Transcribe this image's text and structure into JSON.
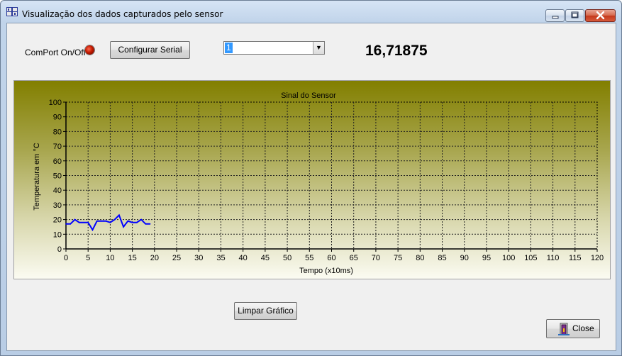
{
  "window": {
    "title": "Visualização dos dados capturados pelo sensor"
  },
  "toolbar": {
    "comport_label": "ComPort On/Off",
    "configure_label": "Configurar Serial",
    "port_select_value": "1",
    "reading_value": "16,71875"
  },
  "actions": {
    "clear_label": "Limpar Gráfico",
    "close_label": "Close"
  },
  "colors": {
    "series_line": "#0000ff",
    "led": "#cc2200"
  },
  "chart_data": {
    "type": "line",
    "title": "Sinal do Sensor",
    "xlabel": "Tempo (x10ms)",
    "ylabel": "Temperatura em °C",
    "xlim": [
      0,
      120
    ],
    "ylim": [
      0,
      100
    ],
    "xticks": [
      0,
      5,
      10,
      15,
      20,
      25,
      30,
      35,
      40,
      45,
      50,
      55,
      60,
      65,
      70,
      75,
      80,
      85,
      90,
      95,
      100,
      105,
      110,
      115,
      120
    ],
    "yticks": [
      0,
      10,
      20,
      30,
      40,
      50,
      60,
      70,
      80,
      90,
      100
    ],
    "grid": true,
    "series": [
      {
        "x": [
          0,
          1,
          2,
          3,
          4,
          5,
          6,
          7,
          8,
          9,
          10,
          11,
          12,
          13,
          14,
          15,
          16,
          17,
          18,
          19
        ],
        "values": [
          17,
          17,
          20,
          18,
          18,
          18,
          13,
          19,
          19,
          19,
          18,
          20,
          23,
          15,
          19,
          18,
          18,
          20,
          17,
          17
        ]
      }
    ]
  }
}
